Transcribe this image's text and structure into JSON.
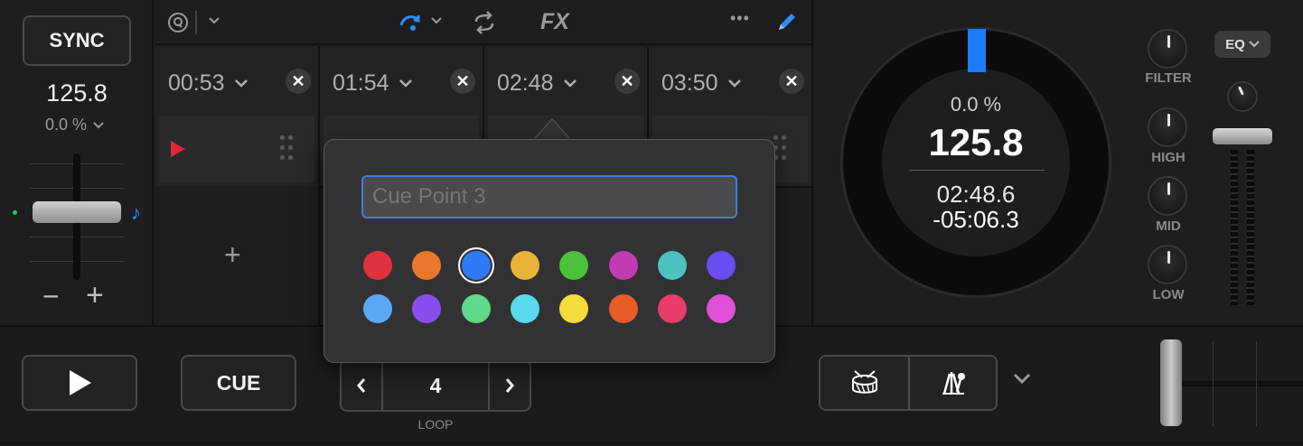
{
  "left": {
    "sync_label": "SYNC",
    "bpm": "125.8",
    "pitch": "0.0 %",
    "minus": "−",
    "plus": "+"
  },
  "toolbar": {
    "icons": [
      "quantize-icon",
      "chevron-down-icon",
      "slip-mode-icon",
      "chevron-down-icon",
      "loop-arrows-icon",
      "fx-icon",
      "more-icon",
      "edit-pencil-icon"
    ],
    "fx_label": "FX",
    "more_label": "•••"
  },
  "cues": [
    {
      "time": "00:53",
      "color": "#e0273a"
    },
    {
      "time": "01:54",
      "color": null
    },
    {
      "time": "02:48",
      "color": null
    },
    {
      "time": "03:50",
      "color": null
    }
  ],
  "add_cue_label": "+",
  "popover": {
    "name_placeholder": "Cue Point 3",
    "selected_color_index": 2,
    "colors": [
      "#e0323c",
      "#e8782e",
      "#2f7bf5",
      "#e8b43a",
      "#4cc13b",
      "#c33bb3",
      "#4bc2c0",
      "#6a4cf0",
      "#5aa8f5",
      "#8a4ef0",
      "#5fd88a",
      "#5ad8ee",
      "#f4dc3a",
      "#e85c28",
      "#e83c6a",
      "#e050d8"
    ]
  },
  "platter": {
    "pitch": "0.0 %",
    "bpm": "125.8",
    "elapsed": "02:48.6",
    "remaining": "-05:06.3"
  },
  "eq": {
    "menu_label": "EQ",
    "knobs": [
      "FILTER",
      "HIGH",
      "MID",
      "LOW"
    ]
  },
  "bottom": {
    "cue_label": "CUE",
    "loop_value": "4",
    "loop_label": "LOOP",
    "pad_icons": [
      "drum-icon",
      "instruments-icon"
    ]
  }
}
